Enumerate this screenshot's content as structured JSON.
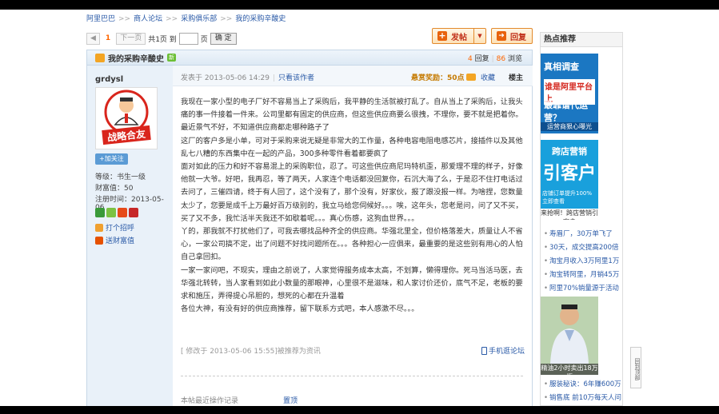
{
  "breadcrumb": [
    "阿里巴巴",
    "商人论坛",
    "采购俱乐部",
    "我的采购辛酸史"
  ],
  "pager": {
    "prev": "上一页",
    "current": "1",
    "next": "下一页",
    "total": "共1页 到",
    "page_suffix": "页",
    "go": "确 定"
  },
  "actions": {
    "post": "发帖",
    "reply": "回复"
  },
  "thread": {
    "title": "我的采购辛酸史",
    "new_badge": "新",
    "reply_count": "4",
    "reply_label": "回复",
    "view_count": "86",
    "view_label": "浏览"
  },
  "user": {
    "name": "grdysl",
    "follow": "+加关注",
    "level": "等级：书生一级",
    "wealth": "财富值：50",
    "reg_time": "注册时间：2013-05-06",
    "call": "打个招呼",
    "send": "送财富值"
  },
  "post": {
    "posted": "发表于 2013-05-06 14:29",
    "only_author": "只看该作者",
    "reward": "悬赏奖励：50点",
    "favorite": "收藏",
    "floor": "楼主",
    "paragraphs": [
      "我现在一家小型的电子厂好不容易当上了采购后，我平静的生活就被打乱了。自从当上了采购后，让我头痛的事一件接着一件来。公司里都有固定的供应商，但这些供应商要么很拽，不理你，要不就是把着你。最近景气不好，不知道供应商都走哪种路子了",
      "这厂的客户多是小单，可对于采购来说无疑是非常大的工作量，各种电容电阻电感芯片，接插件以及其他乱七八糟的东西集中在一起的产品，300多种零件看着都要疯了",
      "面对如此的压力和好不容易混上的采购职位，忍了。可这些供应商尼玛特机歪，那爱理不理的样子，好像他就一大爷。好吧，我再忍，等了两天，人家连个电话都没回复你，石沉大海了么，于是忍不住打电话过去问了，三催四请，终于有人回了，这个没有了，那个没有，好家伙，报了跟没报一样。为啥捏，您数量太少了，您要是成千上万最好百万级别的，我立马给您伺候好。。。唉，这年头，您老是问，问了又不买，买了又不多，我忙活半天我还不如歇着呢。。。真心伤感，这狗血世界。。。",
      "丫的，那我就不打扰他们了，可我去哪找品种齐全的供应商。华强北里全，但价格落差大，质量让人不省心，一家公司搞不定，出了问题不好找问题所在。。。各种担心一应俱来，最重要的是这些别有用心的人怕自己拿回扣。",
      "一家一家问吧，不现实，理由之前说了，人家觉得服务成本太高，不划算，懒得理你。死马当活马医，去华强北转转，当人家看到如此小数量的那眼神，心里很不是滋味，和人家讨价还价，底气不足，老板的要求和施压，弄得提心吊胆的，想死的心都在升温着",
      "各位大神，有没有好的供应商推荐，留下联系方式吧，本人感激不尽。。。"
    ],
    "edited": "[ 修改于 2013-05-06 15:55]被推荐为资讯",
    "mobile": "手机逛论坛",
    "op_record": "本帖最近操作记录",
    "op_action": "置顶"
  },
  "sidebar": {
    "title": "热点推荐",
    "ad1": {
      "l1": "真相调查",
      "l2": "谁是阿里平台上",
      "l3": "最靠谱代运营？",
      "l4": "运营商狠心曝光"
    },
    "ad2": {
      "t1": "跨店营销",
      "t2": "引客户",
      "t3": "店铺订单提升100% 立即查看",
      "t4": "来抢啊！跨店营销引客户"
    },
    "list1": [
      "寿眉厂，30万单飞了",
      "30天，成交提高200倍",
      "淘宝月收入3万阿里1万",
      "淘宝转阿里，月销45万",
      "阿里70%销量源于活动"
    ],
    "ad3_caption": "精油2小时卖出18万瓶",
    "list2": [
      "服装秘诀：6年赚600万",
      "销售底 前10万每天人问"
    ]
  },
  "totop": "回到顶部"
}
